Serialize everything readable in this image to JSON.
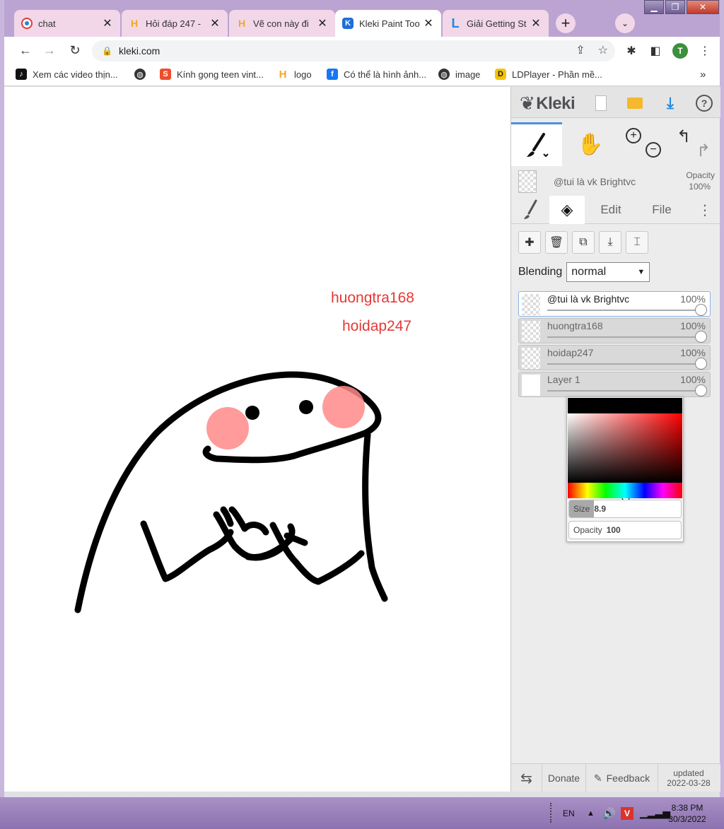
{
  "browser": {
    "tabs": [
      {
        "label": "chat",
        "icon": "chat-favicon"
      },
      {
        "label": "Hỏi đáp 247 -",
        "icon": "hoidap-favicon"
      },
      {
        "label": "Vẽ con này đi",
        "icon": "hoidap-favicon"
      },
      {
        "label": "Kleki Paint Too",
        "icon": "kleki-favicon",
        "active": true
      },
      {
        "label": "Giải Getting St",
        "icon": "l-favicon"
      }
    ],
    "new_tab": "+",
    "url": "kleki.com",
    "avatar_letter": "T",
    "bookmarks": [
      {
        "label": "Xem các video thịn..."
      },
      {
        "label": ""
      },
      {
        "label": "Kính gọng teen vint..."
      },
      {
        "label": "logo"
      },
      {
        "label": "Có thể là hình ảnh..."
      },
      {
        "label": "image"
      },
      {
        "label": "LDPlayer - Phần mề..."
      }
    ],
    "bookmarks_more": "»"
  },
  "canvas": {
    "texts": [
      "huongtra168",
      "hoidap247"
    ],
    "text_color": "#e53935"
  },
  "kleki": {
    "logo": "Kleki",
    "current_layer_name": "@tui là vk Brightvc",
    "opacity_label": "Opacity",
    "opacity_value": "100%",
    "tabs": {
      "edit": "Edit",
      "file": "File"
    },
    "blending_label": "Blending",
    "blending_value": "normal",
    "layers": [
      {
        "name": "@tui là vk Brightvc",
        "opacity": "100%",
        "selected": true
      },
      {
        "name": "huongtra168",
        "opacity": "100%"
      },
      {
        "name": "hoidap247",
        "opacity": "100%"
      },
      {
        "name": "Layer 1",
        "opacity": "100%"
      }
    ],
    "picker": {
      "size_label": "Size",
      "size_value": "8.9",
      "opacity_label": "Opacity",
      "opacity_value": "100",
      "color": "#000000"
    },
    "footer": {
      "donate": "Donate",
      "feedback": "Feedback",
      "updated_label": "updated",
      "updated_date": "2022-03-28"
    }
  },
  "taskbar": {
    "lang": "EN",
    "time": "8:38 PM",
    "date": "30/3/2022"
  },
  "colors": {
    "accent": "#4a90e2",
    "download": "#1e88e5",
    "folder": "#f5b82e"
  }
}
